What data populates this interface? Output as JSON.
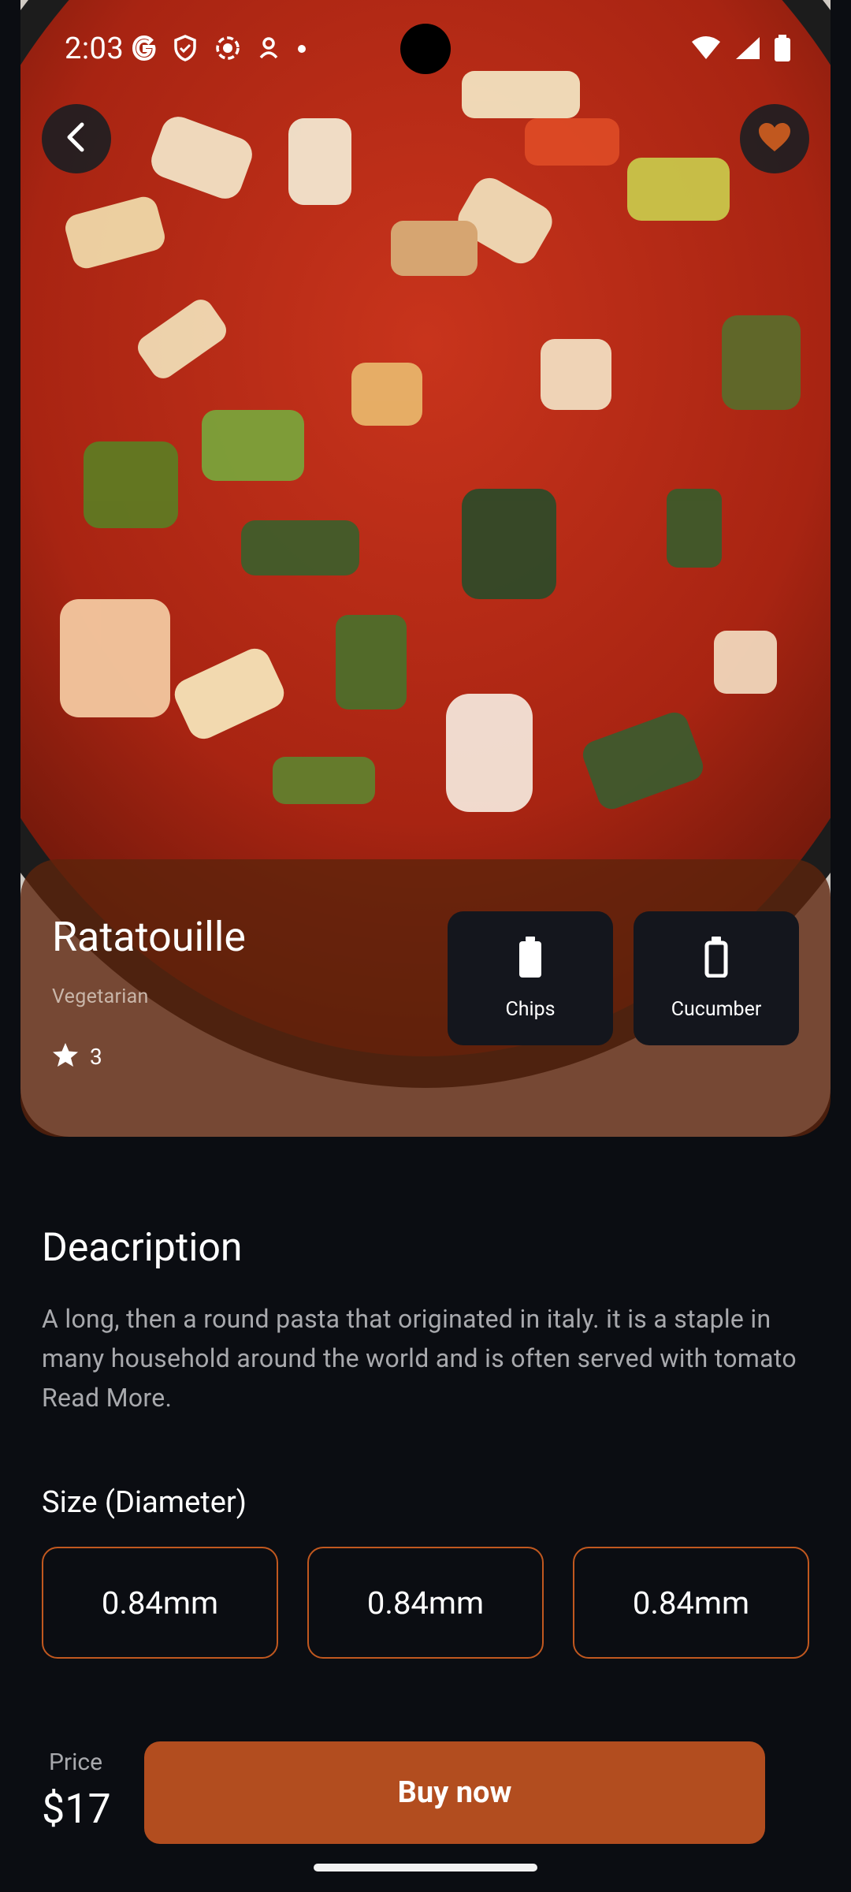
{
  "status_bar": {
    "time": "2:03",
    "left_icons": [
      "google-icon",
      "shield-icon",
      "record-icon",
      "location-icon",
      "dot-icon"
    ],
    "right_icons": [
      "wifi-icon",
      "signal-icon",
      "battery-icon"
    ]
  },
  "hero": {
    "image": "ratatouille-photo",
    "favorite": true
  },
  "dish": {
    "title": "Ratatouille",
    "category": "Vegetarian",
    "rating": "3"
  },
  "tags": [
    {
      "label": "Chips",
      "icon": "battery-full-icon"
    },
    {
      "label": "Cucumber",
      "icon": "battery-empty-icon"
    }
  ],
  "description": {
    "title": "Deacription",
    "text": "A long, then a round pasta that originated in italy. it is a staple in many household around the world and is often served with tomato Read More."
  },
  "size": {
    "title": "Size (Diameter)",
    "options": [
      "0.84mm",
      "0.84mm",
      "0.84mm"
    ]
  },
  "purchase": {
    "price_label": "Price",
    "price_value": "$17",
    "buy_label": "Buy now"
  },
  "colors": {
    "background": "#0b0d12",
    "accent": "#b24d1f",
    "card": "#14161d",
    "favorite": "#c1581f"
  }
}
